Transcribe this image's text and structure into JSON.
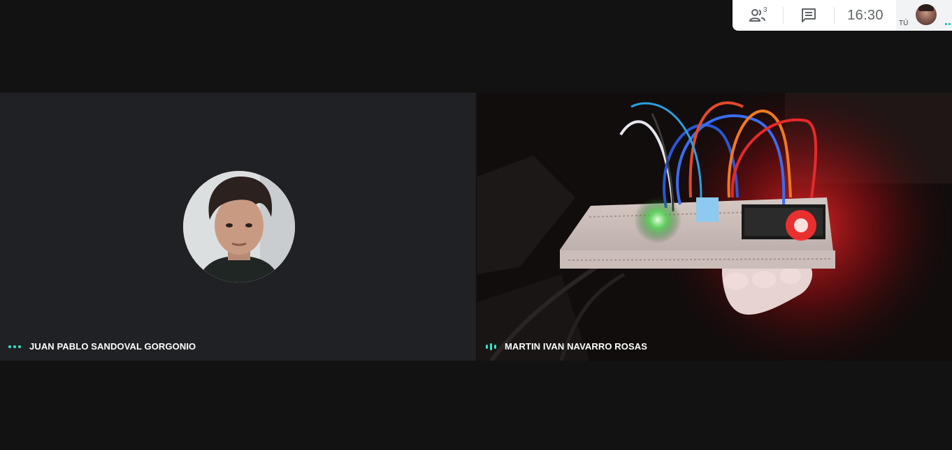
{
  "topbar": {
    "people_count": "3",
    "time": "16:30",
    "self_label": "TÚ",
    "icons": [
      "people-icon",
      "chat-icon"
    ]
  },
  "participants": [
    {
      "name": "JUAN PABLO SANDOVAL GORGONIO",
      "audio_indicator": "dots-idle"
    },
    {
      "name": "MARTIN IVAN NAVARRO ROSAS",
      "audio_indicator": "bars-speaking"
    }
  ],
  "colors": {
    "background": "#121212",
    "tile": "#202124",
    "accent": "#34e5c8",
    "topbar_bg": "#ffffff",
    "topbar_text": "#5f6368"
  }
}
